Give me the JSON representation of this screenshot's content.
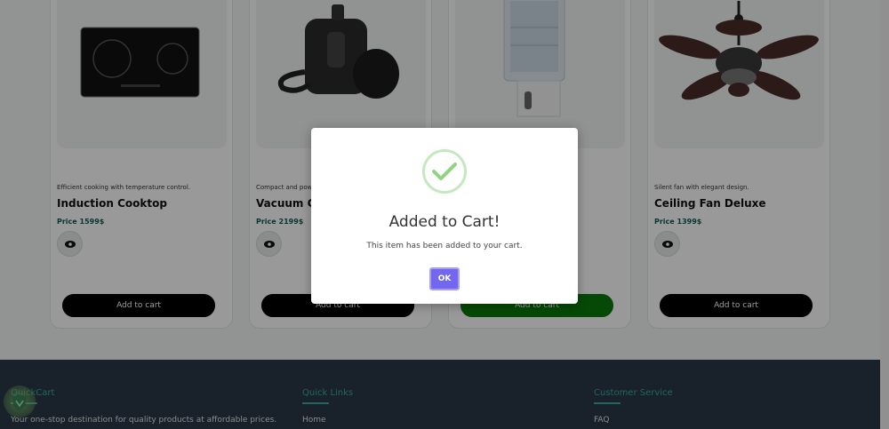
{
  "products": [
    {
      "description": "Efficient cooking with temperature control.",
      "title": "Induction Cooktop",
      "price": "Price 1599$",
      "button": "Add to cart",
      "added": false
    },
    {
      "description": "Compact and powerful vacuum cleaner.",
      "title": "Vacuum Cleaner",
      "price": "Price 2199$",
      "button": "Add to cart",
      "added": false
    },
    {
      "description": "",
      "title": "",
      "price": "",
      "button": "Add to cart",
      "added": true
    },
    {
      "description": "Silent fan with elegant design.",
      "title": "Ceiling Fan Deluxe",
      "price": "Price 1399$",
      "button": "Add to cart",
      "added": false
    }
  ],
  "footer": {
    "brand": {
      "title": "QuickCart",
      "text": "Your one-stop destination for quality products at affordable prices."
    },
    "quick_links": {
      "title": "Quick Links",
      "first": "Home"
    },
    "customer_service": {
      "title": "Customer Service",
      "first": "FAQ"
    }
  },
  "modal": {
    "title": "Added to Cart!",
    "text": "This item has been added to your cart.",
    "ok_label": "OK"
  },
  "colors": {
    "accent_teal": "#3aa8a0",
    "footer_bg": "#2b3a49",
    "ok_button": "#7367f0",
    "added_button": "#0a7a0a",
    "success_check": "#8fd383"
  }
}
